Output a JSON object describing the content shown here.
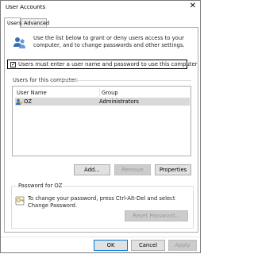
{
  "window": {
    "title": "User Accounts"
  },
  "tabs": [
    {
      "label": "Users",
      "active": true
    },
    {
      "label": "Advanced",
      "active": false
    }
  ],
  "intro_text": "Use the list below to grant or deny users access to your computer, and to change passwords and other settings.",
  "require_login": {
    "checked": true,
    "label": "Users must enter a user name and password to use this computer"
  },
  "users_section_label": "Users for this computer:",
  "users_table": {
    "columns": [
      "User Name",
      "Group"
    ],
    "rows": [
      {
        "name": "OZ",
        "group": "Administrators",
        "selected": true
      }
    ]
  },
  "user_buttons": {
    "add": "Add...",
    "remove": "Remove",
    "properties": "Properties"
  },
  "password_group": {
    "label": "Password for OZ",
    "text": "To change your password, press Ctrl-Alt-Del and select Change Password.",
    "reset_button": "Reset Password..."
  },
  "dialog_buttons": {
    "ok": "OK",
    "cancel": "Cancel",
    "apply": "Apply"
  },
  "colors": {
    "selection": "#d9d9d9",
    "disabled_text": "#9a9a9a"
  }
}
